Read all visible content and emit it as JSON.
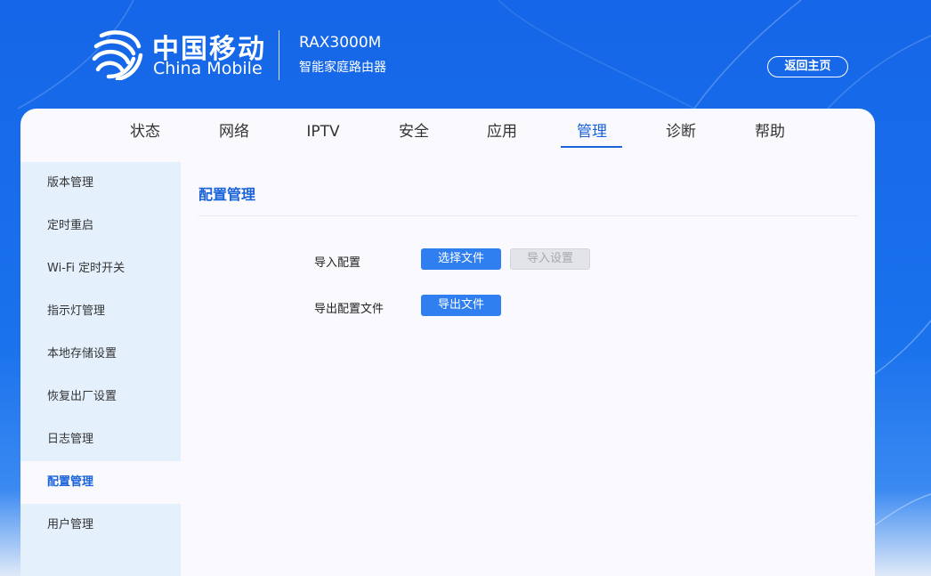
{
  "header": {
    "logo_cn": "中国移动",
    "logo_en": "China Mobile",
    "model": "RAX3000M",
    "product": "智能家庭路由器",
    "home_button": "返回主页"
  },
  "nav": {
    "items": [
      "状态",
      "网络",
      "IPTV",
      "安全",
      "应用",
      "管理",
      "诊断",
      "帮助"
    ],
    "active": "管理"
  },
  "sidebar": {
    "items": [
      "版本管理",
      "定时重启",
      "Wi-Fi 定时开关",
      "指示灯管理",
      "本地存储设置",
      "恢复出厂设置",
      "日志管理",
      "配置管理",
      "用户管理"
    ],
    "active": "配置管理"
  },
  "content": {
    "title": "配置管理",
    "import_label": "导入配置",
    "choose_file_button": "选择文件",
    "import_settings_button": "导入设置",
    "export_label": "导出配置文件",
    "export_file_button": "导出文件"
  },
  "colors": {
    "brand_blue": "#1566e8",
    "accent": "#1a63d8",
    "button_primary": "#2f7ff0",
    "sidebar_bg": "#e4f1fd"
  },
  "icons": [
    "china-mobile-logo-icon"
  ]
}
